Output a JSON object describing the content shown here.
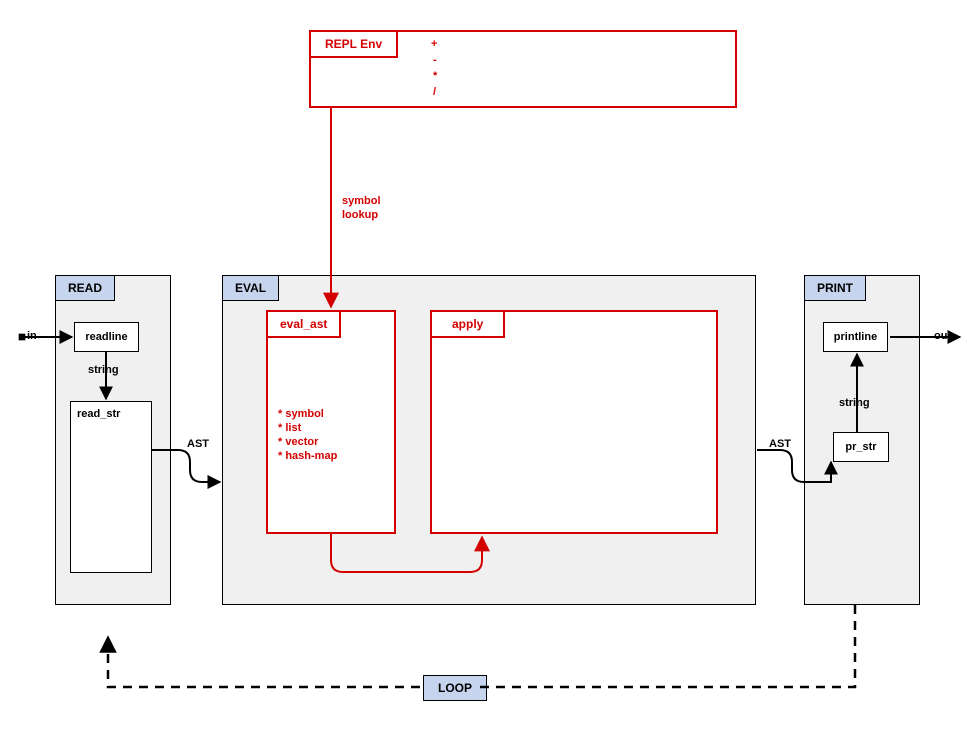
{
  "repl_env": {
    "title": "REPL Env",
    "ops": [
      "+",
      "-",
      "*",
      "/"
    ]
  },
  "read": {
    "title": "READ",
    "readline": "readline",
    "read_str": "read_str",
    "string_label": "string"
  },
  "eval": {
    "title": "EVAL",
    "eval_ast": {
      "title": "eval_ast",
      "items": [
        "* symbol",
        "* list",
        "* vector",
        "* hash-map"
      ]
    },
    "apply": {
      "title": "apply"
    }
  },
  "print": {
    "title": "PRINT",
    "printline": "printline",
    "pr_str": "pr_str",
    "string_label": "string"
  },
  "loop": "LOOP",
  "labels": {
    "in": "in",
    "out": "out",
    "ast_left": "AST",
    "ast_right": "AST",
    "symbol_lookup_1": "symbol",
    "symbol_lookup_2": "lookup"
  }
}
